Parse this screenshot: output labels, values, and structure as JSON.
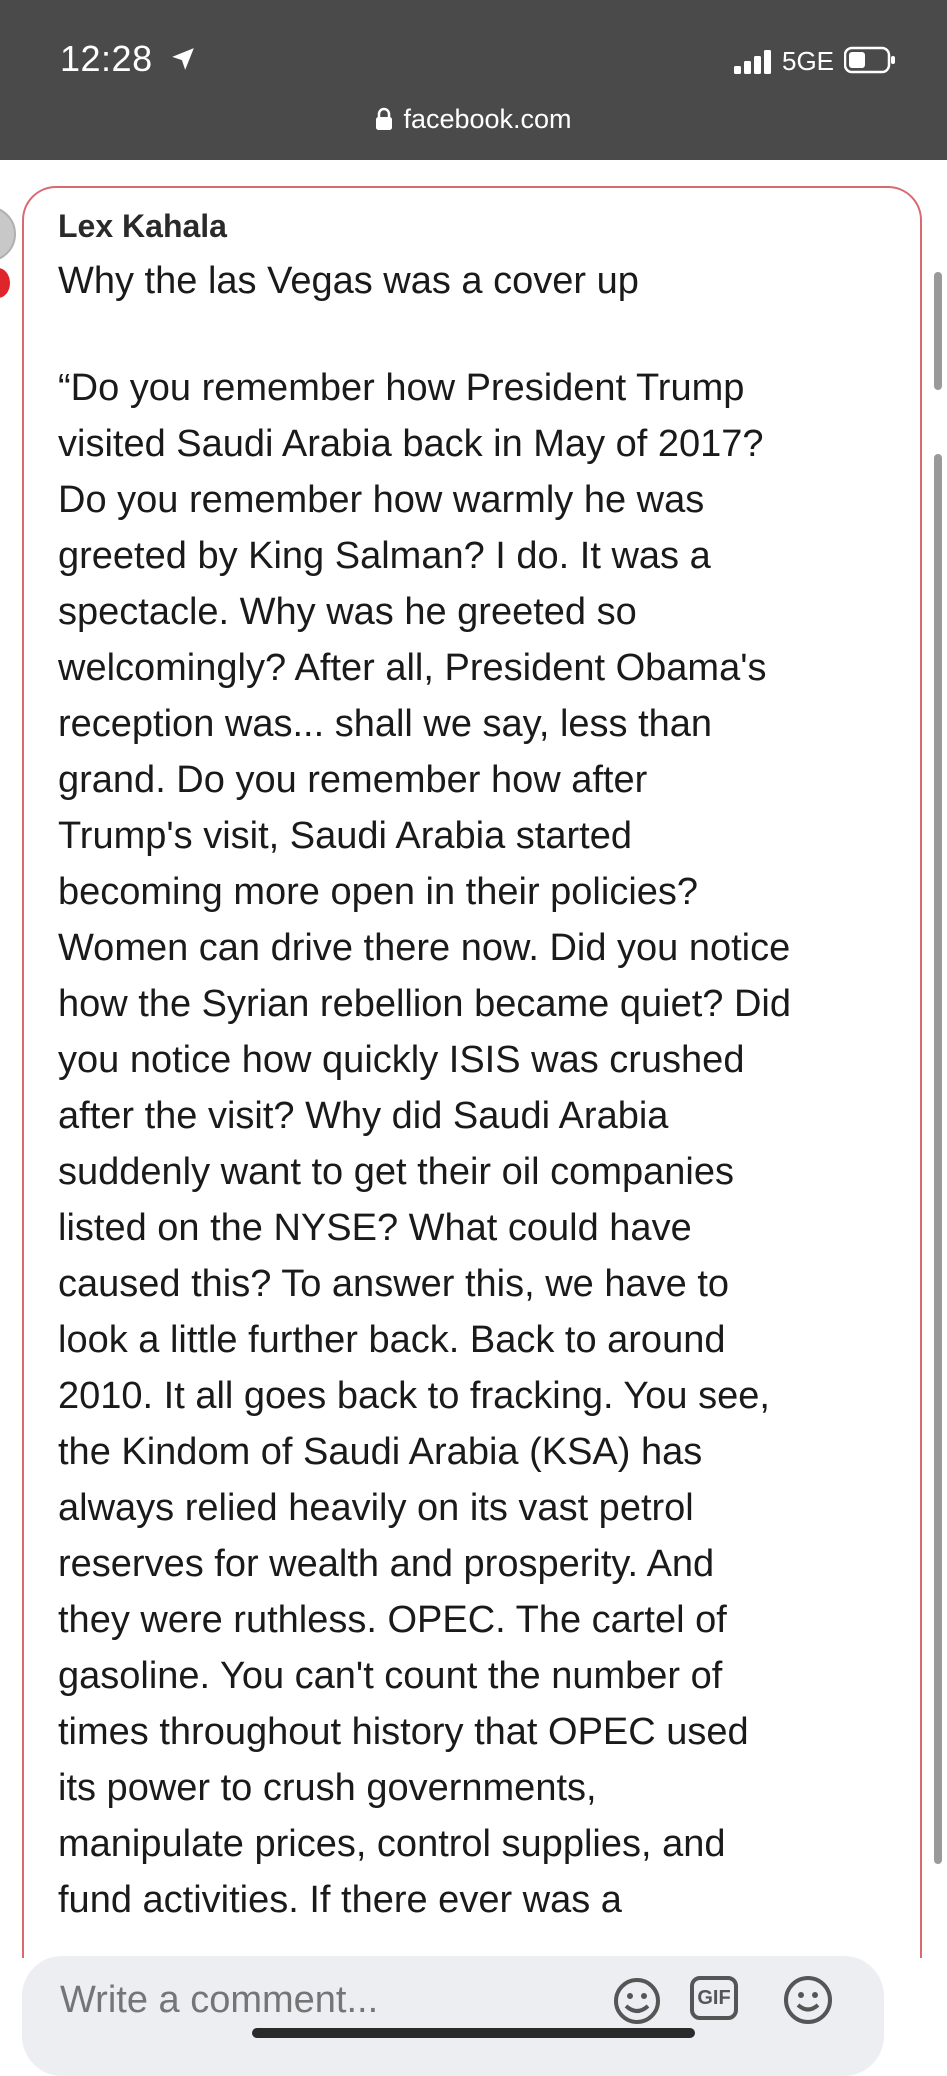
{
  "status_bar": {
    "time": "12:28",
    "network": "5GE"
  },
  "browser": {
    "url": "facebook.com"
  },
  "comment": {
    "author": "Lex Kahala",
    "title": "Why the las Vegas was a cover up",
    "body_lines": [
      "“Do you remember how President Trump",
      "visited Saudi Arabia back in May of 2017?",
      "Do you remember how warmly he was",
      "greeted by King Salman? I do. It was a",
      "spectacle. Why was he greeted so",
      "welcomingly? After all, President Obama's",
      "reception was... shall we say, less than",
      "grand. Do you remember how after",
      "Trump's visit, Saudi Arabia started",
      "becoming more open in their policies?",
      "Women can drive there now. Did you notice",
      "how the Syrian rebellion became quiet? Did",
      "you notice how quickly ISIS was crushed",
      "after the visit? Why did Saudi Arabia",
      "suddenly want to get their oil companies",
      "listed on the NYSE? What could have",
      "caused this? To answer this, we have to",
      "look a little further back. Back to around",
      "2010. It all goes back to fracking. You see,",
      "the Kindom of Saudi Arabia (KSA) has",
      "always relied heavily on its vast petrol",
      "reserves for wealth and prosperity. And",
      "they were ruthless. OPEC. The cartel of",
      "gasoline. You can't count the number of",
      "times throughout history that OPEC used",
      "its power to crush governments,",
      "manipulate prices, control supplies, and",
      "fund activities. If there ever was a"
    ]
  },
  "composer": {
    "placeholder": "Write a comment...",
    "gif_label": "GIF"
  },
  "icons": {
    "location": "location-arrow-icon",
    "signal": "signal-bars-icon",
    "battery": "battery-icon",
    "lock": "lock-icon",
    "sticker": "sticker-icon",
    "gif": "gif-icon",
    "emoji": "emoji-icon"
  }
}
